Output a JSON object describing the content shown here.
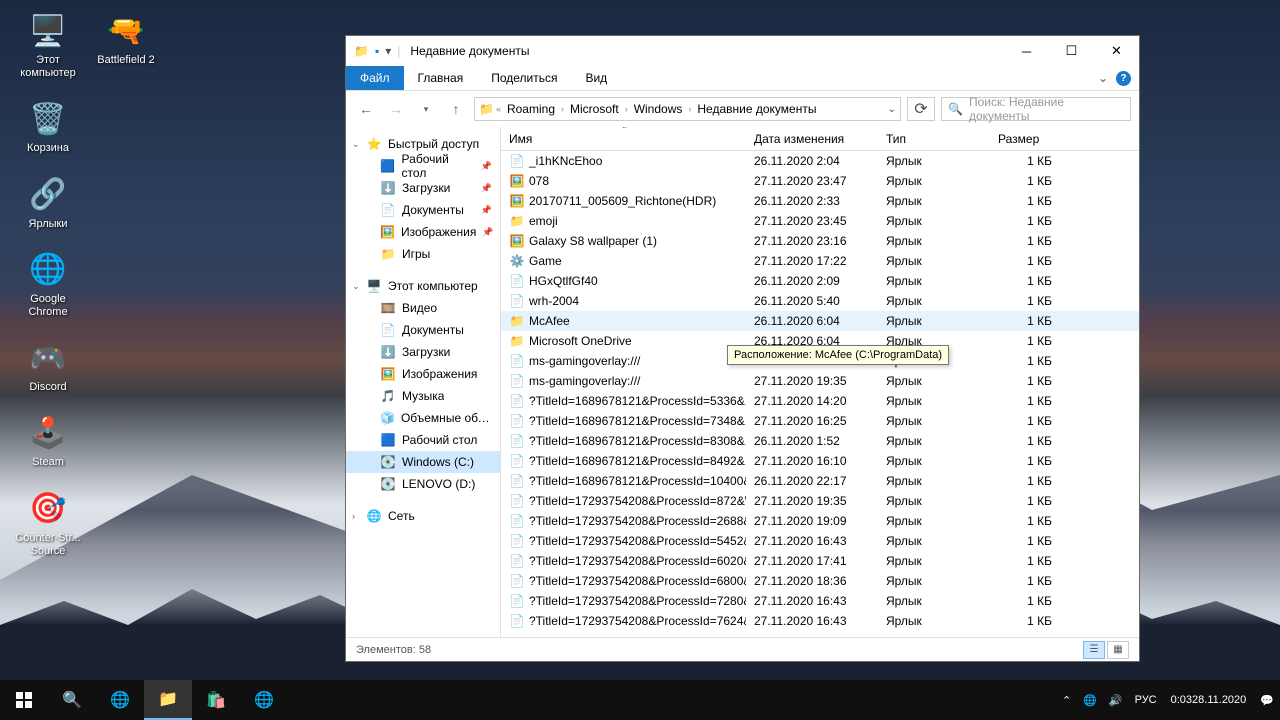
{
  "desktop": {
    "icons": [
      {
        "name": "this-pc",
        "label": "Этот\nкомпьютер",
        "emoji": "🖥️"
      },
      {
        "name": "recycle-bin",
        "label": "Корзина",
        "emoji": "🗑️"
      },
      {
        "name": "shortcuts",
        "label": "Ярлыки",
        "emoji": "🔗"
      },
      {
        "name": "google-chrome",
        "label": "Google\nChrome",
        "emoji": "🌐"
      },
      {
        "name": "discord",
        "label": "Discord",
        "emoji": "🎮"
      },
      {
        "name": "steam",
        "label": "Steam",
        "emoji": "🕹️"
      },
      {
        "name": "counter-strike-source",
        "label": "Counter-Str...\nSource",
        "emoji": "🎯"
      }
    ],
    "icons_col2": [
      {
        "name": "battlefield-2",
        "label": "Battlefield 2",
        "emoji": "🔫"
      }
    ]
  },
  "explorer": {
    "title": "Недавние документы",
    "ribbon": {
      "file": "Файл",
      "home": "Главная",
      "share": "Поделиться",
      "view": "Вид"
    },
    "breadcrumb": [
      "Roaming",
      "Microsoft",
      "Windows",
      "Недавние документы"
    ],
    "search_placeholder": "Поиск: Недавние документы",
    "columns": {
      "name": "Имя",
      "date": "Дата изменения",
      "type": "Тип",
      "size": "Размер"
    },
    "nav": {
      "quick_access": "Быстрый доступ",
      "qa_items": [
        {
          "label": "Рабочий стол",
          "pin": true,
          "ico": "🟦"
        },
        {
          "label": "Загрузки",
          "pin": true,
          "ico": "⬇️"
        },
        {
          "label": "Документы",
          "pin": true,
          "ico": "📄"
        },
        {
          "label": "Изображения",
          "pin": true,
          "ico": "🖼️"
        },
        {
          "label": "Игры",
          "pin": false,
          "ico": "📁"
        }
      ],
      "this_pc": "Этот компьютер",
      "pc_items": [
        {
          "label": "Видео",
          "ico": "🎞️"
        },
        {
          "label": "Документы",
          "ico": "📄"
        },
        {
          "label": "Загрузки",
          "ico": "⬇️"
        },
        {
          "label": "Изображения",
          "ico": "🖼️"
        },
        {
          "label": "Музыка",
          "ico": "🎵"
        },
        {
          "label": "Объемные объекты",
          "ico": "🧊"
        },
        {
          "label": "Рабочий стол",
          "ico": "🟦"
        },
        {
          "label": "Windows (C:)",
          "ico": "💽",
          "sel": true
        },
        {
          "label": "LENOVO (D:)",
          "ico": "💽"
        }
      ],
      "network": "Сеть"
    },
    "files": [
      {
        "name": "_i1hKNcEhoo",
        "date": "26.11.2020 2:04",
        "type": "Ярлык",
        "size": "1 КБ",
        "ico": "📄"
      },
      {
        "name": "078",
        "date": "27.11.2020 23:47",
        "type": "Ярлык",
        "size": "1 КБ",
        "ico": "🖼️"
      },
      {
        "name": "20170711_005609_Richtone(HDR)",
        "date": "26.11.2020 2:33",
        "type": "Ярлык",
        "size": "1 КБ",
        "ico": "🖼️"
      },
      {
        "name": "emoji",
        "date": "27.11.2020 23:45",
        "type": "Ярлык",
        "size": "1 КБ",
        "ico": "📁"
      },
      {
        "name": "Galaxy S8 wallpaper (1)",
        "date": "27.11.2020 23:16",
        "type": "Ярлык",
        "size": "1 КБ",
        "ico": "🖼️"
      },
      {
        "name": "Game",
        "date": "27.11.2020 17:22",
        "type": "Ярлык",
        "size": "1 КБ",
        "ico": "⚙️"
      },
      {
        "name": "HGxQtlfGf40",
        "date": "26.11.2020 2:09",
        "type": "Ярлык",
        "size": "1 КБ",
        "ico": "📄"
      },
      {
        "name": "wrh-2004",
        "date": "26.11.2020 5:40",
        "type": "Ярлык",
        "size": "1 КБ",
        "ico": "📄"
      },
      {
        "name": "McAfee",
        "date": "26.11.2020 6:04",
        "type": "Ярлык",
        "size": "1 КБ",
        "ico": "📁",
        "hl": true
      },
      {
        "name": "Microsoft OneDrive",
        "date": "26.11.2020 6:04",
        "type": "Ярлык",
        "size": "1 КБ",
        "ico": "📁"
      },
      {
        "name": "ms-gamingoverlay:///",
        "date": "",
        "type": "Ярлык",
        "size": "1 КБ",
        "ico": "📄"
      },
      {
        "name": "ms-gamingoverlay:///",
        "date": "27.11.2020 19:35",
        "type": "Ярлык",
        "size": "1 КБ",
        "ico": "📄"
      },
      {
        "name": "?TitleId=1689678121&ProcessId=5336&...",
        "date": "27.11.2020 14:20",
        "type": "Ярлык",
        "size": "1 КБ",
        "ico": "📄"
      },
      {
        "name": "?TitleId=1689678121&ProcessId=7348&...",
        "date": "27.11.2020 16:25",
        "type": "Ярлык",
        "size": "1 КБ",
        "ico": "📄"
      },
      {
        "name": "?TitleId=1689678121&ProcessId=8308&...",
        "date": "26.11.2020 1:52",
        "type": "Ярлык",
        "size": "1 КБ",
        "ico": "📄"
      },
      {
        "name": "?TitleId=1689678121&ProcessId=8492&...",
        "date": "27.11.2020 16:10",
        "type": "Ярлык",
        "size": "1 КБ",
        "ico": "📄"
      },
      {
        "name": "?TitleId=1689678121&ProcessId=10400&...",
        "date": "26.11.2020 22:17",
        "type": "Ярлык",
        "size": "1 КБ",
        "ico": "📄"
      },
      {
        "name": "?TitleId=17293754208&ProcessId=872&Wi...",
        "date": "27.11.2020 19:35",
        "type": "Ярлык",
        "size": "1 КБ",
        "ico": "📄"
      },
      {
        "name": "?TitleId=17293754208&ProcessId=2688&...",
        "date": "27.11.2020 19:09",
        "type": "Ярлык",
        "size": "1 КБ",
        "ico": "📄"
      },
      {
        "name": "?TitleId=17293754208&ProcessId=5452&...",
        "date": "27.11.2020 16:43",
        "type": "Ярлык",
        "size": "1 КБ",
        "ico": "📄"
      },
      {
        "name": "?TitleId=17293754208&ProcessId=6020&...",
        "date": "27.11.2020 17:41",
        "type": "Ярлык",
        "size": "1 КБ",
        "ico": "📄"
      },
      {
        "name": "?TitleId=17293754208&ProcessId=6800&...",
        "date": "27.11.2020 18:36",
        "type": "Ярлык",
        "size": "1 КБ",
        "ico": "📄"
      },
      {
        "name": "?TitleId=17293754208&ProcessId=7280&...",
        "date": "27.11.2020 16:43",
        "type": "Ярлык",
        "size": "1 КБ",
        "ico": "📄"
      },
      {
        "name": "?TitleId=17293754208&ProcessId=7624&...",
        "date": "27.11.2020 16:43",
        "type": "Ярлык",
        "size": "1 КБ",
        "ico": "📄"
      }
    ],
    "tooltip": "Расположение: McAfee (C:\\ProgramData)",
    "status": "Элементов: 58"
  },
  "taskbar": {
    "tray": {
      "lang": "РУС",
      "time": "0:03",
      "date": "28.11.2020"
    }
  }
}
